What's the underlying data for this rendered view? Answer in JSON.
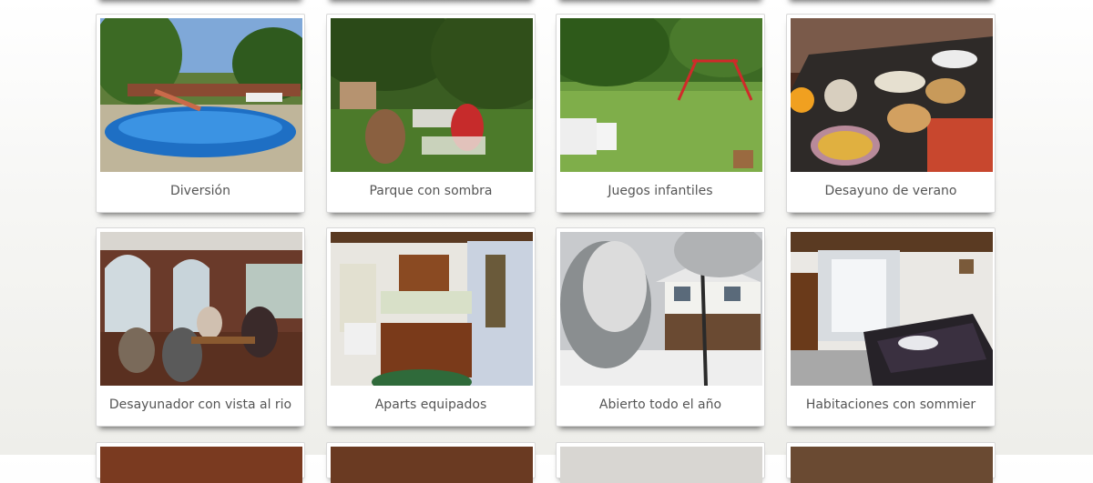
{
  "gallery": {
    "items": [
      {
        "caption": "Diversión"
      },
      {
        "caption": "Parque con sombra"
      },
      {
        "caption": "Juegos infantiles"
      },
      {
        "caption": "Desayuno de verano"
      },
      {
        "caption": "Desayunador con vista al rio"
      },
      {
        "caption": "Aparts equipados"
      },
      {
        "caption": "Abierto todo el año"
      },
      {
        "caption": "Habitaciones con sommier"
      }
    ]
  }
}
